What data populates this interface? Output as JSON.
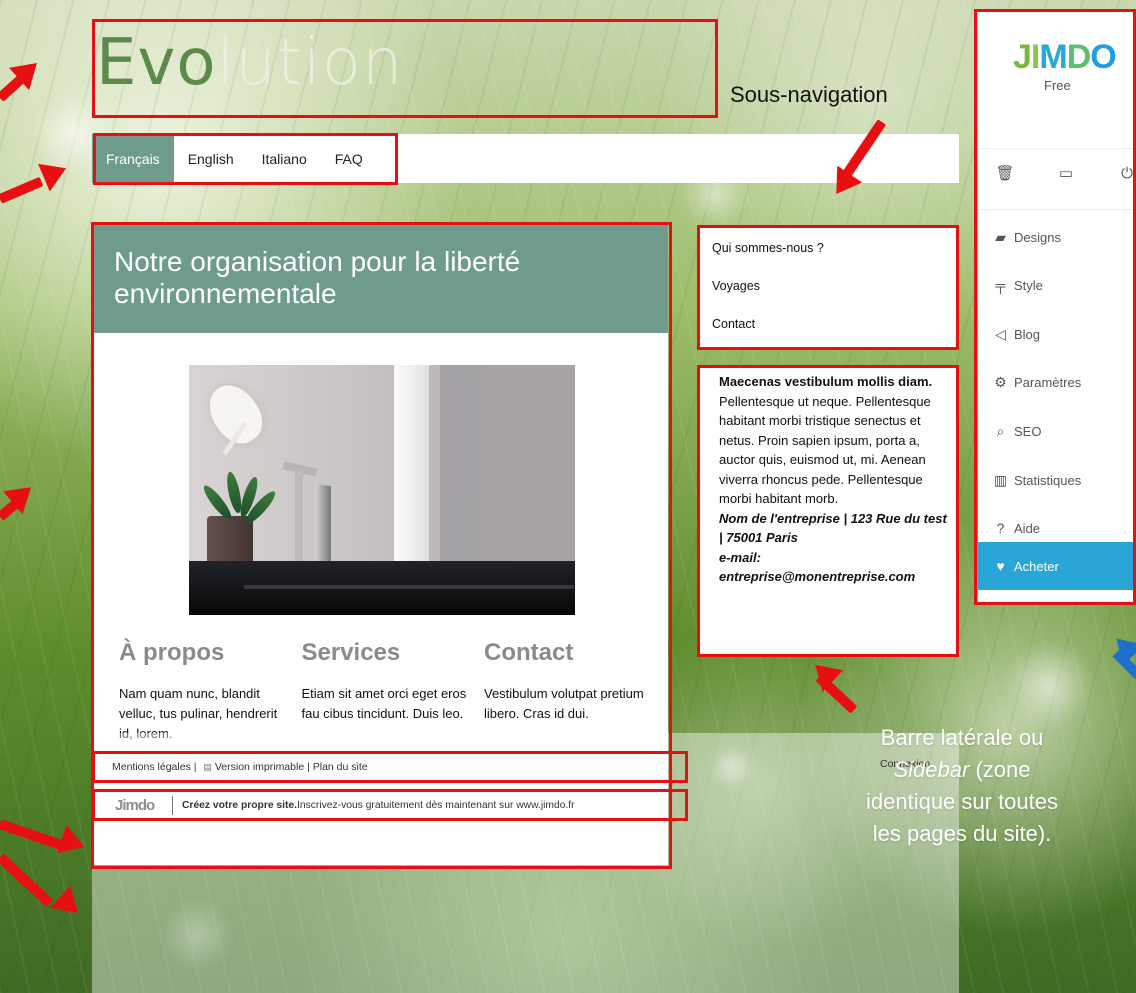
{
  "site": {
    "logo": {
      "main": "Evo",
      "tail": "lution"
    },
    "nav": [
      "Français",
      "English",
      "Italiano",
      "FAQ"
    ],
    "content": {
      "title": "Notre organisation pour la liberté environnementale",
      "columns": [
        {
          "title": "À propos",
          "body": "Nam quam nunc, blandit velluc, tus pulinar, hendrerit id, lorem."
        },
        {
          "title": "Services",
          "body": "Etiam sit amet orci eget eros fau cibus tincidunt. Duis leo."
        },
        {
          "title": "Contact",
          "body": "Vestibulum volutpat pretium libero. Cras id dui."
        }
      ]
    },
    "subnav": [
      "Qui sommes-nous ?",
      "Voyages",
      "Contact"
    ],
    "sidebar": {
      "bold": "Maecenas vestibulum mollis diam.",
      "body": " Pellentesque ut neque. Pellentesque habitant morbi tristique senectus et netus. Proin sapien ipsum, porta a, auctor quis, euismod ut, mi. Aenean viverra rhoncus pede. Pellentesque morbi habitant morb.",
      "company": "Nom de l'entreprise |  123 Rue du test | 75001 Paris",
      "email_label": "e-mail:",
      "email": "entreprise@monentreprise.com"
    },
    "footer": {
      "mentions": "Mentions légales",
      "printable": "Version imprimable",
      "sitemap": "Plan du site",
      "connexion": "Connexion",
      "brand": "Jimdo",
      "ad_bold": "Créez votre propre site.",
      "ad_text": " Inscrivez-vous gratuitement dès maintenant sur www.jimdo.fr"
    }
  },
  "admin_panel": {
    "brand": "JIMDO",
    "plan": "Free",
    "tools": [
      "trash-icon",
      "monitor-icon",
      "power-icon"
    ],
    "menu": [
      {
        "label": "Designs",
        "icon": "designs-icon"
      },
      {
        "label": "Style",
        "icon": "paint-roller-icon"
      },
      {
        "label": "Blog",
        "icon": "megaphone-icon"
      },
      {
        "label": "Paramètres",
        "icon": "gear-icon"
      },
      {
        "label": "SEO",
        "icon": "search-icon"
      },
      {
        "label": "Statistiques",
        "icon": "bar-chart-icon"
      },
      {
        "label": "Aide",
        "icon": "help-icon"
      },
      {
        "label": "Acheter",
        "icon": "heart-icon"
      }
    ]
  },
  "annotations": {
    "subnav_label": "Sous-navigation",
    "sidebar_label_line_1": "Barre latérale ou",
    "sidebar_label_line_2_italic": "Sidebar",
    "sidebar_label_line_2_rest": " (zone",
    "sidebar_label_line_3": "identique sur toutes",
    "sidebar_label_line_4": "les pages du site)."
  },
  "colors": {
    "accent": "#6f9b8d",
    "annotation_red": "#e80f12",
    "admin_active_blue": "#2aa6d6",
    "annotation_blue": "#1e70c8"
  }
}
